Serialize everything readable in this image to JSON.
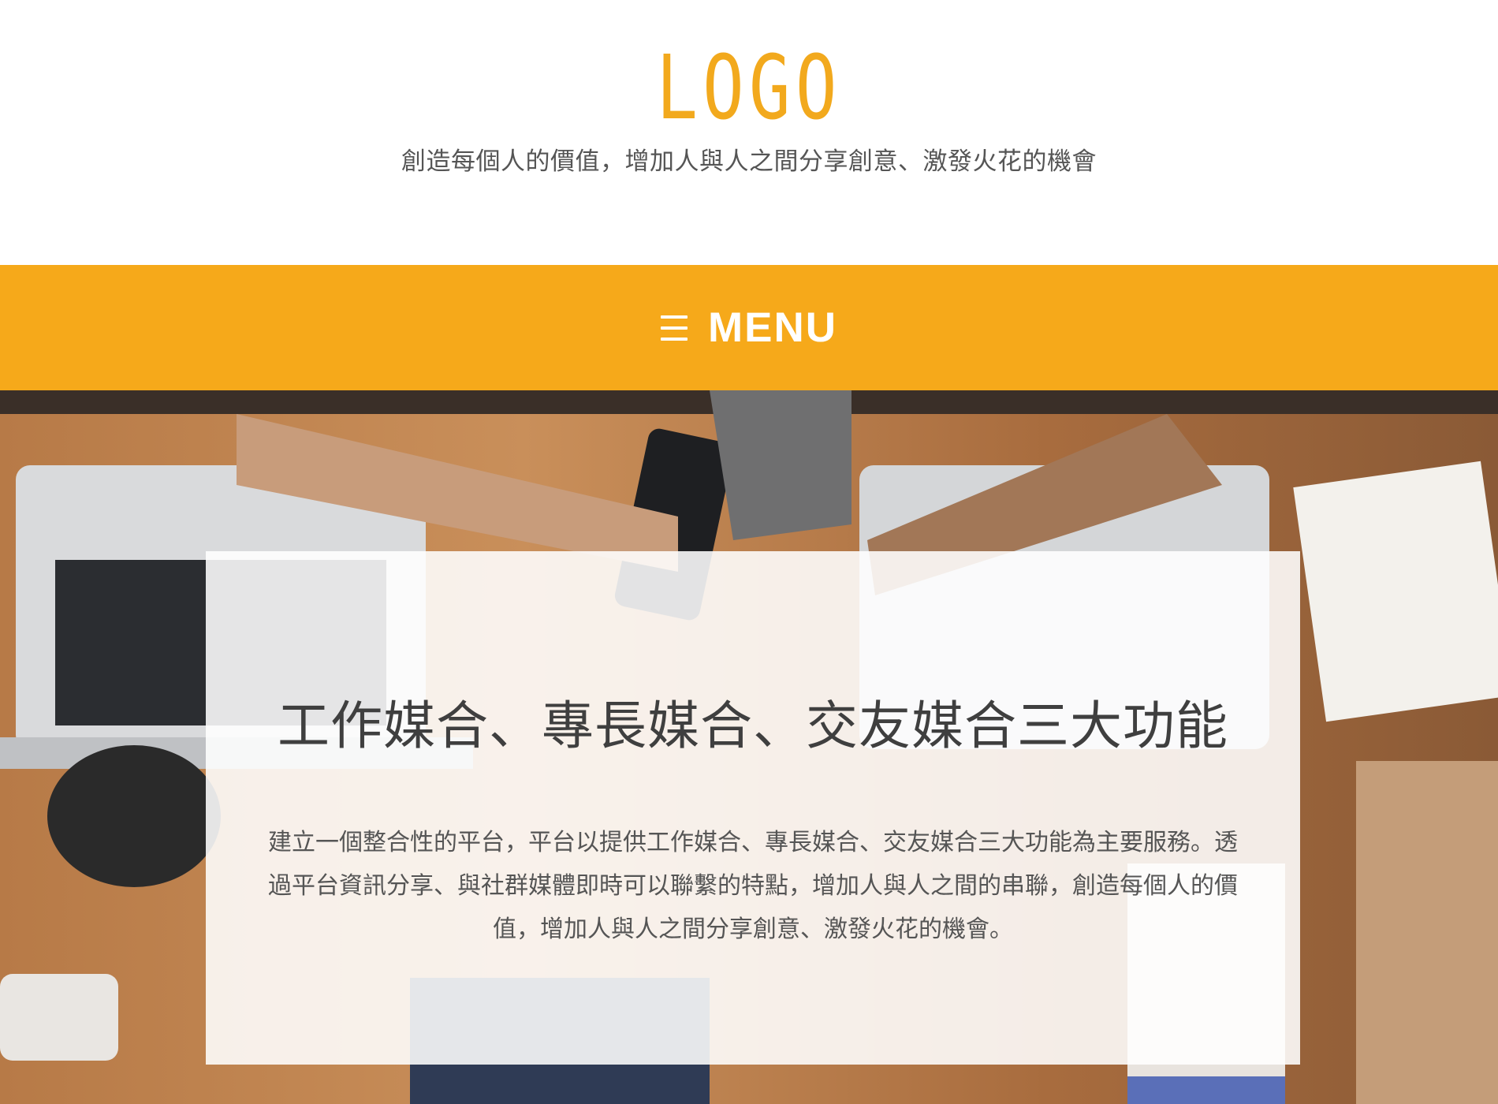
{
  "brand": {
    "logo_text": "LOGO",
    "tagline": "創造每個人的價值，增加人與人之間分享創意、激發火花的機會",
    "accent_color": "#f6a91a"
  },
  "nav": {
    "menu_icon": "hamburger-icon",
    "menu_label": "MENU"
  },
  "hero": {
    "title": "工作媒合、專長媒合、交友媒合三大功能",
    "description": "建立一個整合性的平台，平台以提供工作媒合、專長媒合、交友媒合三大功能為主要服務。透過平台資訊分享、與社群媒體即時可以聯繫的特點，增加人與人之間的串聯，創造每個人的價值，增加人與人之間分享創意、激發火花的機會。"
  }
}
